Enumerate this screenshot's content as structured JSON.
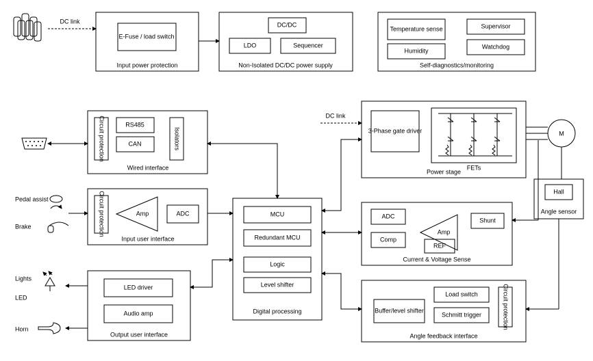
{
  "labels": {
    "dcLink1": "DC link",
    "dcLink2": "DC link",
    "inputPowerProtection": "Input power protection",
    "eFuse": "E-Fuse / load switch",
    "nonIsolated": "Non-Isolated DC/DC power supply",
    "dcdc": "DC/DC",
    "ldo": "LDO",
    "sequencer": "Sequencer",
    "selfDiag": "Self-diagnostics/monitoring",
    "tempSense": "Temperature sense",
    "supervisor": "Supervisor",
    "humidity": "Humidity",
    "watchdog": "Watchdog",
    "wiredInterface": "Wired interface",
    "circuitProt": "Circuit protection",
    "rs485": "RS485",
    "can": "CAN",
    "isolators": "Isolators",
    "pedalAssist": "Pedal assist",
    "brake": "Brake",
    "inputUI": "Input user interface",
    "amp": "Amp",
    "adc": "ADC",
    "lights": "Lights",
    "led": "LED",
    "horn": "Horn",
    "outputUI": "Output user interface",
    "ledDriver": "LED driver",
    "audioAmp": "Audio amp",
    "digitalProcessing": "Digital processing",
    "mcu": "MCU",
    "redundantMcu": "Redundant MCU",
    "logic": "Logic",
    "levelShifter": "Level shifter",
    "powerStage": "Power stage",
    "gateDriver": "3-Phase gate driver",
    "fets": "FETs",
    "motor": "M",
    "angleSensor": "Angle sensor",
    "hall": "Hall",
    "cvSense": "Current & Voltage Sense",
    "comp": "Comp",
    "ref": "REF",
    "shunt": "Shunt",
    "angleFeedback": "Angle feedback interface",
    "bufferLevel": "Buffer/level shifter",
    "loadSwitch": "Load switch",
    "schmitt": "Schmitt trigger"
  }
}
